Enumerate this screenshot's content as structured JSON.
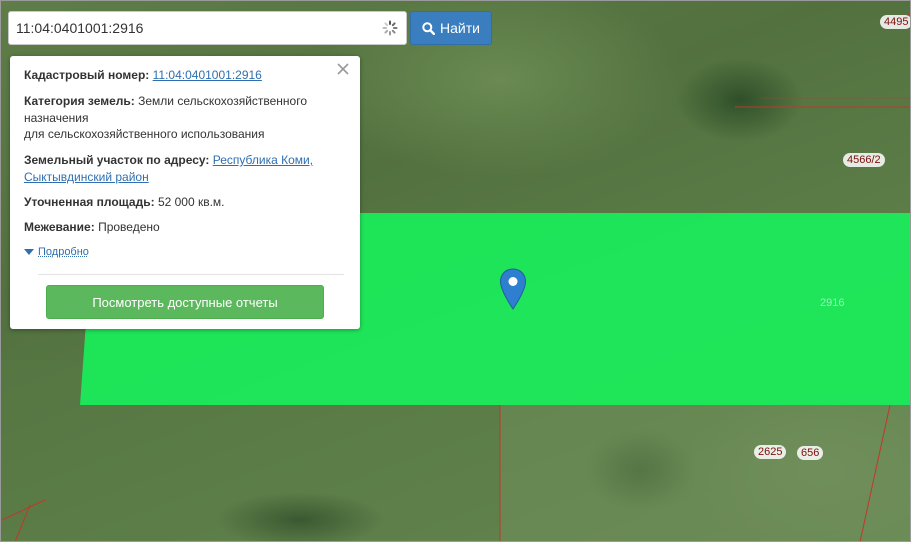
{
  "search": {
    "value": "11:04:0401001:2916",
    "button_label": "Найти"
  },
  "info": {
    "cadastral_label": "Кадастровый номер:",
    "cadastral_value": "11:04:0401001:2916",
    "category_label": "Категория земель:",
    "category_value_line1": "Земли сельскохозяйственного назначения",
    "category_value_line2": "для сельскохозяйственного использования",
    "address_label": "Земельный участок по адресу:",
    "address_value": "Республика Коми, Сыктывдинский район",
    "area_label": "Уточненная площадь:",
    "area_value": "52 000 кв.м.",
    "survey_label": "Межевание:",
    "survey_value": "Проведено",
    "more_label": "Подробно",
    "reports_button": "Посмотреть доступные отчеты"
  },
  "map": {
    "parcel_labels": [
      "4495",
      "4566/2",
      "2916",
      "2625",
      "656"
    ],
    "parcel_color": "#1aed5a",
    "boundary_color": "#c0392b"
  },
  "icons": {
    "search": "magnifier-icon",
    "loading": "spinner-icon",
    "close": "close-icon",
    "expand": "triangle-down-icon",
    "marker": "map-marker-icon"
  }
}
